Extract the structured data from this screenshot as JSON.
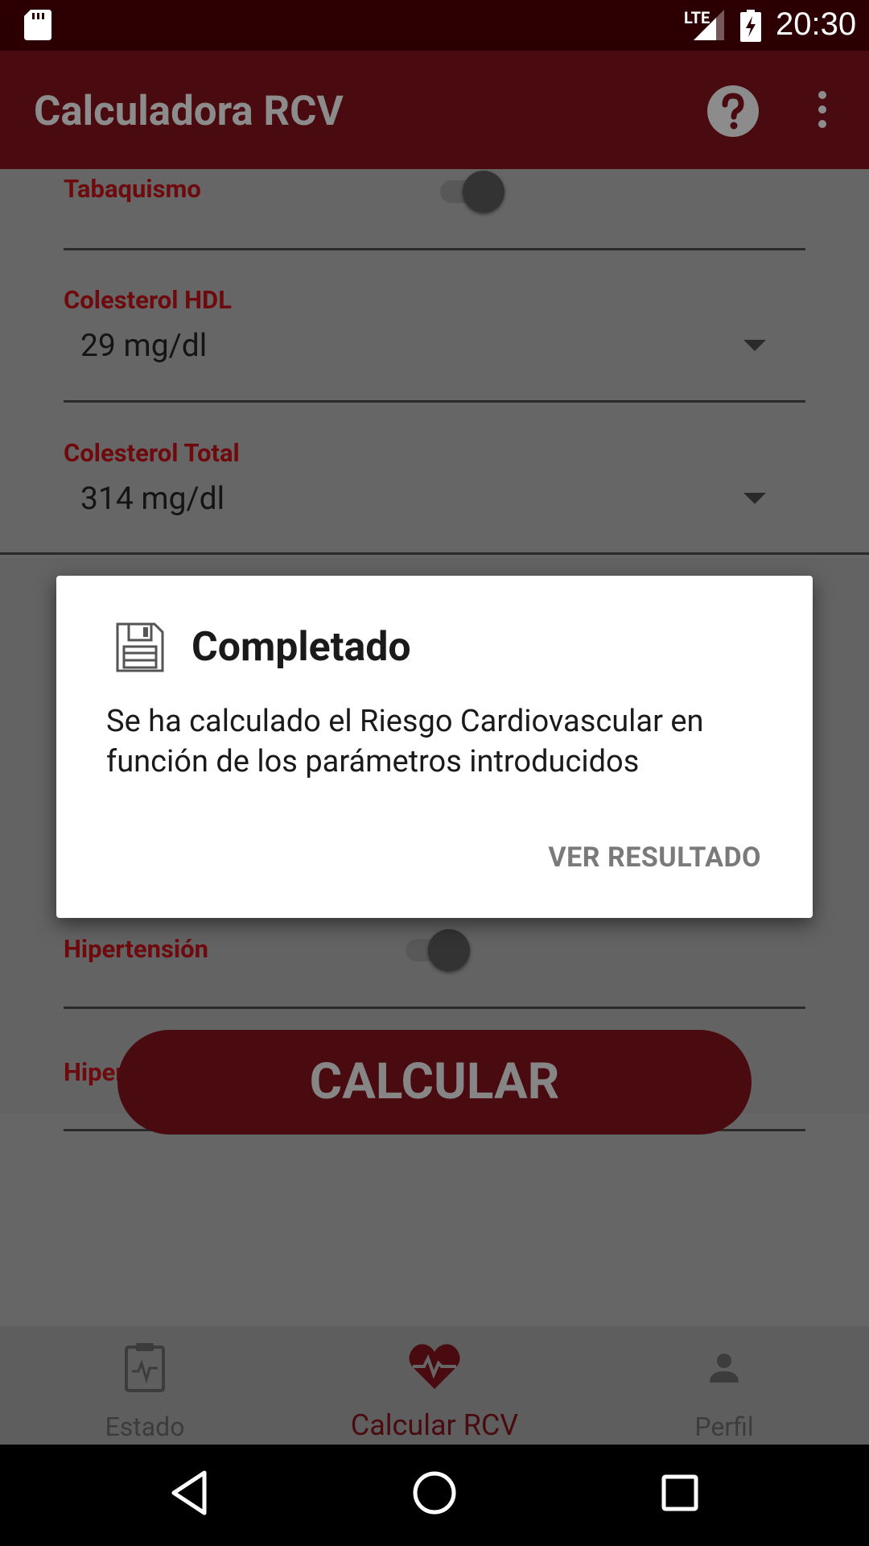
{
  "status_bar": {
    "network": "LTE",
    "time": "20:30",
    "icons": [
      "sd-card-icon",
      "signal-icon",
      "battery-charging-icon"
    ]
  },
  "toolbar": {
    "title": "Calculadora RCV",
    "icons": [
      "help-icon",
      "more-vert-icon"
    ]
  },
  "form": {
    "tabaquismo": {
      "label": "Tabaquismo",
      "state": "on"
    },
    "hdl": {
      "label": "Colesterol HDL",
      "value": "29 mg/dl"
    },
    "total": {
      "label": "Colesterol Total",
      "value": "314 mg/dl"
    },
    "hipertension": {
      "label": "Hipertensión",
      "state": "on"
    },
    "hipertrofia": {
      "label": "Hipertrofia",
      "state": "off"
    },
    "calc_button": "CALCULAR"
  },
  "dialog": {
    "icon": "save-icon",
    "title": "Completado",
    "message": "Se ha calculado el Riesgo Cardiovascular en función de los parámetros introducidos",
    "button": "VER RESULTADO"
  },
  "bottom_nav": {
    "items": [
      {
        "label": "Estado",
        "icon": "clipboard-pulse-icon",
        "active": false
      },
      {
        "label": "Calcular RCV",
        "icon": "heart-pulse-icon",
        "active": true
      },
      {
        "label": "Perfil",
        "icon": "person-icon",
        "active": false
      }
    ]
  },
  "system_nav": [
    "back-icon",
    "home-icon",
    "recents-icon"
  ],
  "colors": {
    "primary_dark": "#2c0003",
    "primary": "#4a0b10",
    "accent_label": "#6e0a0d",
    "scrim_bg": "#666666",
    "dialog_bg": "#ffffff"
  }
}
